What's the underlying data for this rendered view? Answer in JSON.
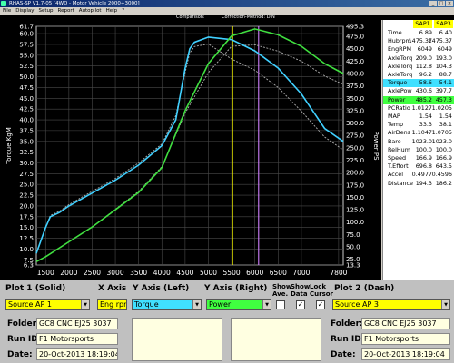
{
  "window": {
    "title": "RHAS-SP V1.7-05   [4WD - Motor Vehicle 2000+3000]",
    "buttons": [
      "_",
      "□",
      "×"
    ]
  },
  "menu": [
    "File",
    "Display",
    "Setup",
    "Report",
    "Autopilot",
    "Help",
    "?"
  ],
  "comparison": {
    "label": "Comparison:",
    "correction": "Correction-Method: DIN"
  },
  "chart_data": {
    "type": "line",
    "xlim": [
      1300,
      7900
    ],
    "x_ticks": [
      1500,
      2000,
      2500,
      3000,
      3500,
      4000,
      4500,
      5000,
      5500,
      6000,
      6500,
      7000,
      7800
    ],
    "y_left_label": "Torque KgM",
    "y_left_ticks": [
      "61.7",
      "60.0",
      "57.5",
      "55.0",
      "52.5",
      "50.0",
      "47.5",
      "45.0",
      "42.5",
      "40.0",
      "37.5",
      "35.0",
      "32.5",
      "30.0",
      "27.5",
      "25.0",
      "22.5",
      "20.0",
      "17.5",
      "15.0",
      "12.5",
      "10.0",
      "7.5",
      "6.3"
    ],
    "y_right_label": "Power PS",
    "y_right_ticks": [
      "495.3",
      "475.0",
      "450.0",
      "425.0",
      "400.0",
      "375.0",
      "350.0",
      "325.0",
      "300.0",
      "275.0",
      "250.0",
      "225.0",
      "200.0",
      "175.0",
      "150.0",
      "125.0",
      "100.0",
      "75.0",
      "50.0",
      "25.0",
      "13.3"
    ],
    "cursors": [
      {
        "name": "SAP1 cursor",
        "x": 5520,
        "color": "#ffff00"
      },
      {
        "name": "SAP3 cursor",
        "x": 6080,
        "color": "#d080ff"
      }
    ],
    "series": [
      {
        "axis": "left",
        "style": "solid",
        "color": "#40d0ff",
        "x": [
          1300,
          1500,
          1600,
          1800,
          2000,
          2500,
          3000,
          3500,
          4000,
          4300,
          4500,
          4600,
          4700,
          5000,
          5500,
          6000,
          6500,
          7000,
          7500,
          7900
        ],
        "y": [
          9,
          15,
          17.5,
          18.5,
          20,
          23,
          26,
          29.5,
          34,
          40,
          52,
          56.5,
          58,
          59.2,
          58.6,
          56,
          52,
          46,
          38,
          35
        ]
      },
      {
        "axis": "left",
        "style": "dashed",
        "color": "#b0b0b0",
        "x": [
          1300,
          1500,
          1600,
          1800,
          2000,
          2500,
          3000,
          3500,
          4000,
          4300,
          4500,
          4600,
          4700,
          5000,
          5500,
          6000,
          6500,
          7000,
          7500,
          7900
        ],
        "y": [
          9,
          15,
          17.8,
          18.8,
          20.3,
          23.4,
          26.4,
          30,
          34.4,
          41,
          51,
          55.5,
          57,
          57.6,
          54.1,
          51.5,
          47.5,
          42,
          36,
          33
        ]
      },
      {
        "axis": "right",
        "style": "solid",
        "color": "#40e040",
        "x": [
          1300,
          1500,
          2000,
          2500,
          3000,
          3500,
          4000,
          4500,
          5000,
          5500,
          6000,
          6500,
          7000,
          7500,
          7900
        ],
        "y": [
          20,
          30,
          60,
          90,
          125,
          160,
          210,
          325,
          420,
          476,
          490,
          478,
          455,
          420,
          400
        ]
      },
      {
        "axis": "right",
        "style": "dashed",
        "color": "#b0b0b0",
        "x": [
          1300,
          1500,
          2000,
          2500,
          3000,
          3500,
          4000,
          4500,
          5000,
          5500,
          6000,
          6500,
          7000,
          7500,
          7900
        ],
        "y": [
          20,
          30,
          60,
          90,
          126,
          162,
          212,
          320,
          402,
          455,
          458,
          445,
          425,
          395,
          378
        ]
      }
    ]
  },
  "datapanel": {
    "headers": [
      "SAP1",
      "SAP3"
    ],
    "rows": [
      {
        "name": "Time",
        "a": "6.89",
        "b": "6.40"
      },
      {
        "name": "Hubrpm",
        "a": "1475.37",
        "b": "1475.37"
      },
      {
        "name": "EngRPM",
        "a": "6049",
        "b": "6049"
      },
      {
        "name": "AxleTorq",
        "a": "209.0",
        "b": "193.0"
      },
      {
        "name": "AxleTorq",
        "a": "112.8",
        "b": "104.3"
      },
      {
        "name": "AxleTorq",
        "a": "96.2",
        "b": "88.7"
      },
      {
        "name": "Torque",
        "a": "58.6",
        "b": "54.1",
        "hl": "#40e0ff"
      },
      {
        "name": "AxlePow",
        "a": "430.6",
        "b": "397.7"
      },
      {
        "name": "Power",
        "a": "485.2",
        "b": "457.3",
        "hl": "#40ff40"
      },
      {
        "name": "PCRatio",
        "a": "1.0127",
        "b": "1.0205"
      },
      {
        "name": "MAP",
        "a": "1.54",
        "b": "1.54"
      },
      {
        "name": "Temp",
        "a": "33.3",
        "b": "38.1"
      },
      {
        "name": "AirDens",
        "a": "1.1047",
        "b": "1.0705"
      },
      {
        "name": "Baro",
        "a": "1023.0",
        "b": "1023.0"
      },
      {
        "name": "RelHum",
        "a": "100.0",
        "b": "100.0"
      },
      {
        "name": "Speed",
        "a": "166.9",
        "b": "166.9"
      },
      {
        "name": "T.Effort",
        "a": "696.8",
        "b": "643.5"
      },
      {
        "name": "Accel",
        "a": "0.4977",
        "b": "0.4596"
      },
      {
        "name": "Distance",
        "a": "194.3",
        "b": "186.2"
      }
    ]
  },
  "controls": {
    "plot1_label": "Plot 1 (Solid)",
    "xaxis_label": "X Axis",
    "yleft_label": "Y Axis (Left)",
    "yright_label": "Y Axis (Right)",
    "show_ave_label": "Show Ave.",
    "show_data_label": "Show Data",
    "lock_cursor_label": "Lock Cursor",
    "plot2_label": "Plot 2 (Dash)",
    "plot1_value": "Source AP 1",
    "xaxis_value": "Eng rpm",
    "yleft_value": "Torque",
    "yright_value": "Power",
    "plot2_value": "Source AP 3",
    "show_ave_checked": "",
    "show_data_checked": "✓",
    "lock_cursor_checked": "✓",
    "folder_label": "Folder:",
    "runid_label": "Run ID:",
    "date_label": "Date:",
    "left_folder": "GC8 CNC EJ25 3037",
    "left_runid": "F1 Motorsports",
    "left_date": "20-Oct-2013  18:19:04",
    "right_folder": "GC8 CNC EJ25 3037",
    "right_runid": "F1 Motorsports",
    "right_date": "20-Oct-2013  18:19:04"
  }
}
